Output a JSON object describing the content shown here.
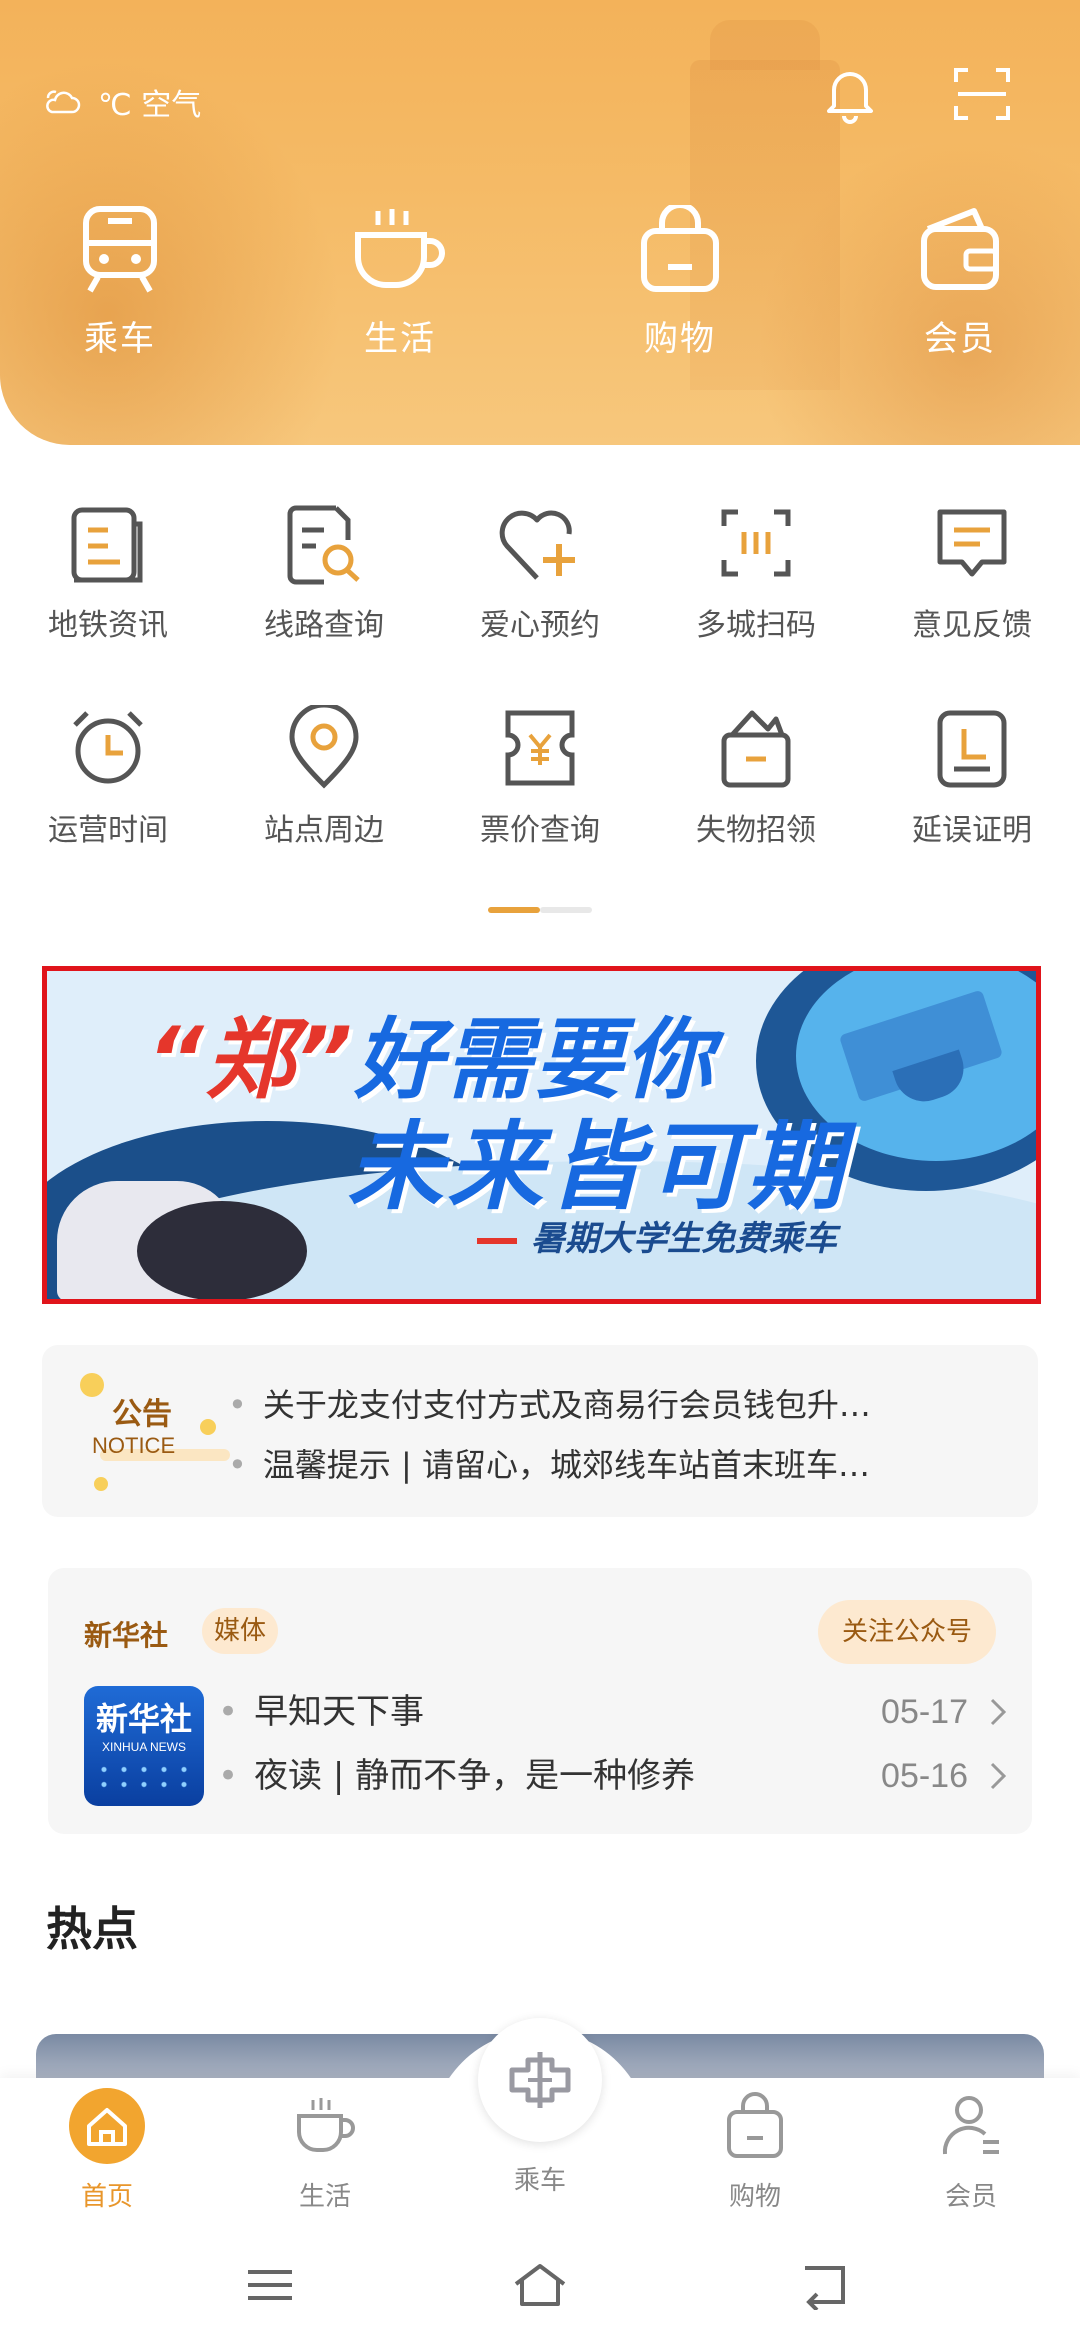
{
  "weather": {
    "text": "℃ 空气"
  },
  "main_nav": [
    {
      "label": "乘车",
      "icon": "train-icon"
    },
    {
      "label": "生活",
      "icon": "coffee-icon"
    },
    {
      "label": "购物",
      "icon": "shopping-bag-icon"
    },
    {
      "label": "会员",
      "icon": "wallet-icon"
    }
  ],
  "quick_grid": [
    {
      "label": "地铁资讯",
      "icon": "news-icon"
    },
    {
      "label": "线路查询",
      "icon": "route-search-icon"
    },
    {
      "label": "爱心预约",
      "icon": "heart-plus-icon"
    },
    {
      "label": "多城扫码",
      "icon": "scan-icon"
    },
    {
      "label": "意见反馈",
      "icon": "feedback-icon"
    },
    {
      "label": "运营时间",
      "icon": "alarm-clock-icon"
    },
    {
      "label": "站点周边",
      "icon": "location-pin-icon"
    },
    {
      "label": "票价查询",
      "icon": "ticket-yuan-icon"
    },
    {
      "label": "失物招领",
      "icon": "lost-found-icon"
    },
    {
      "label": "延误证明",
      "icon": "delay-certificate-icon"
    }
  ],
  "banner": {
    "line1_quote": "“郑”",
    "line1_rest": "好需要你",
    "line2": "未来皆可期",
    "line3": "暑期大学生免费乘车"
  },
  "notice": {
    "badge_zh": "公告",
    "badge_en": "NOTICE",
    "items": [
      "关于龙支付支付方式及商易行会员钱包升…",
      "温馨提示 | 请留心，城郊线车站首末班车…"
    ]
  },
  "media": {
    "name": "新华社",
    "tag": "媒体",
    "follow": "关注公众号",
    "logo_text": "新华社",
    "logo_en": "XINHUA NEWS",
    "articles": [
      {
        "title": "早知天下事",
        "date": "05-17"
      },
      {
        "title": "夜读 | 静而不争，是一种修养",
        "date": "05-16"
      }
    ]
  },
  "hot_title": "热点",
  "tabbar": {
    "items": [
      {
        "label": "首页"
      },
      {
        "label": "生活"
      },
      {
        "label": "乘车"
      },
      {
        "label": "购物"
      },
      {
        "label": "会员"
      }
    ]
  },
  "colors": {
    "accent": "#e8962b",
    "header": "#f5bb67",
    "banner_border": "#e0141b"
  }
}
